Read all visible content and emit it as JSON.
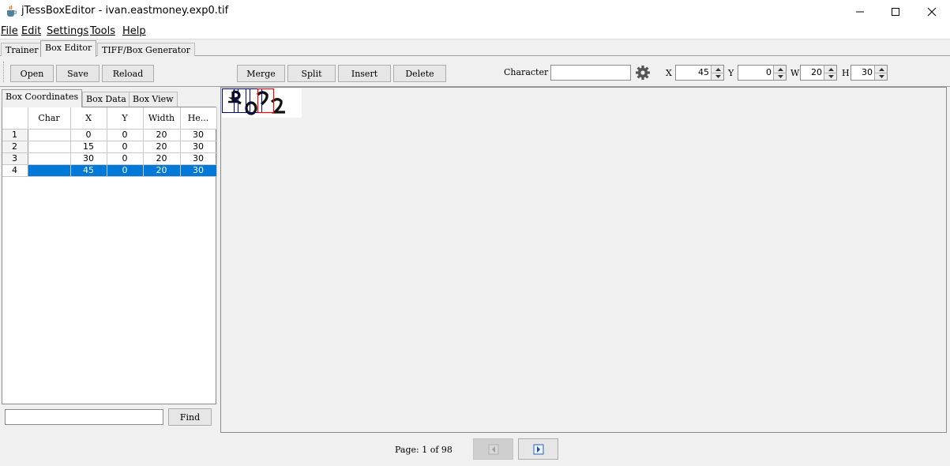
{
  "window": {
    "title": "jTessBoxEditor - ivan.eastmoney.exp0.tif",
    "app_icon": "java-cup-icon"
  },
  "menu": [
    "File",
    "Edit",
    "Settings",
    "Tools",
    "Help"
  ],
  "main_tabs": [
    {
      "label": "Trainer",
      "active": false
    },
    {
      "label": "Box Editor",
      "active": true
    },
    {
      "label": "TIFF/Box Generator",
      "active": false
    }
  ],
  "toolbar": {
    "open": "Open",
    "save": "Save",
    "reload": "Reload",
    "merge": "Merge",
    "split": "Split",
    "insert": "Insert",
    "delete": "Delete",
    "character_label": "Character",
    "character_value": "",
    "settings_icon": "gear-icon",
    "x_label": "X",
    "x_value": "45",
    "y_label": "Y",
    "y_value": "0",
    "w_label": "W",
    "w_value": "20",
    "h_label": "H",
    "h_value": "30"
  },
  "box_tabs": [
    {
      "label": "Box Coordinates",
      "active": true
    },
    {
      "label": "Box Data",
      "active": false
    },
    {
      "label": "Box View",
      "active": false
    }
  ],
  "table": {
    "columns": [
      "",
      "Char",
      "X",
      "Y",
      "Width",
      "He..."
    ],
    "rows": [
      {
        "num": "1",
        "char": "",
        "x": "0",
        "y": "0",
        "w": "20",
        "h": "30"
      },
      {
        "num": "2",
        "char": "",
        "x": "15",
        "y": "0",
        "w": "20",
        "h": "30"
      },
      {
        "num": "3",
        "char": "",
        "x": "30",
        "y": "0",
        "w": "20",
        "h": "30"
      },
      {
        "num": "4",
        "char": "",
        "x": "45",
        "y": "0",
        "w": "20",
        "h": "30"
      }
    ],
    "selected_row": 4
  },
  "find": {
    "value": "",
    "button": "Find"
  },
  "footer": {
    "page_label": "Page: 1 of 98",
    "prev_icon": "prev-page-icon",
    "next_icon": "next-page-icon"
  },
  "colors": {
    "selection": "#0078d7",
    "box_normal": "#00008b",
    "box_selected": "#ff0000"
  }
}
